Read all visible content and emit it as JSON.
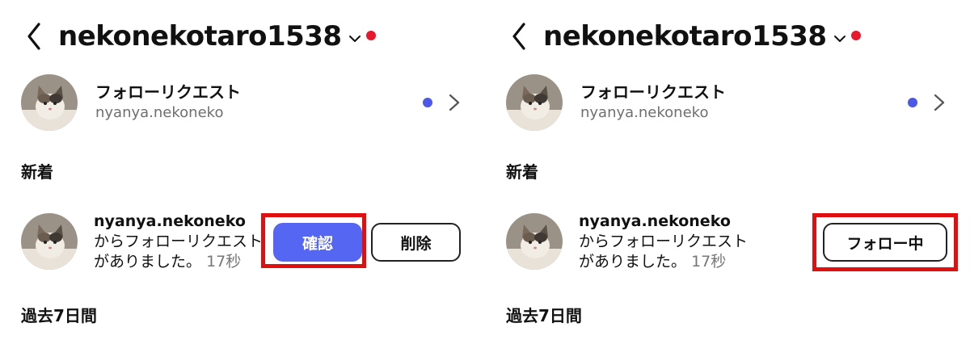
{
  "left": {
    "header": {
      "username": "nekonekotaro1538"
    },
    "follow_request": {
      "title": "フォローリクエスト",
      "subtitle": "nyanya.nekoneko"
    },
    "section_new": "新着",
    "notification": {
      "username": "nyanya.nekoneko",
      "message": "からフォローリクエストがありました。",
      "time": "17秒"
    },
    "buttons": {
      "confirm": "確認",
      "delete": "削除"
    },
    "section_past": "過去7日間"
  },
  "right": {
    "header": {
      "username": "nekonekotaro1538"
    },
    "follow_request": {
      "title": "フォローリクエスト",
      "subtitle": "nyanya.nekoneko"
    },
    "section_new": "新着",
    "notification": {
      "username": "nyanya.nekoneko",
      "message": "からフォローリクエストがありました。",
      "time": "17秒"
    },
    "buttons": {
      "following": "フォロー中"
    },
    "section_past": "過去7日間"
  },
  "colors": {
    "accent_blue": "#5566f3",
    "unread_dot": "#4c58e8",
    "notification_dot": "#e8192c",
    "highlight_red": "#e01010"
  },
  "icons": [
    "back-chevron-icon",
    "chevron-down-icon",
    "chevron-right-icon"
  ]
}
